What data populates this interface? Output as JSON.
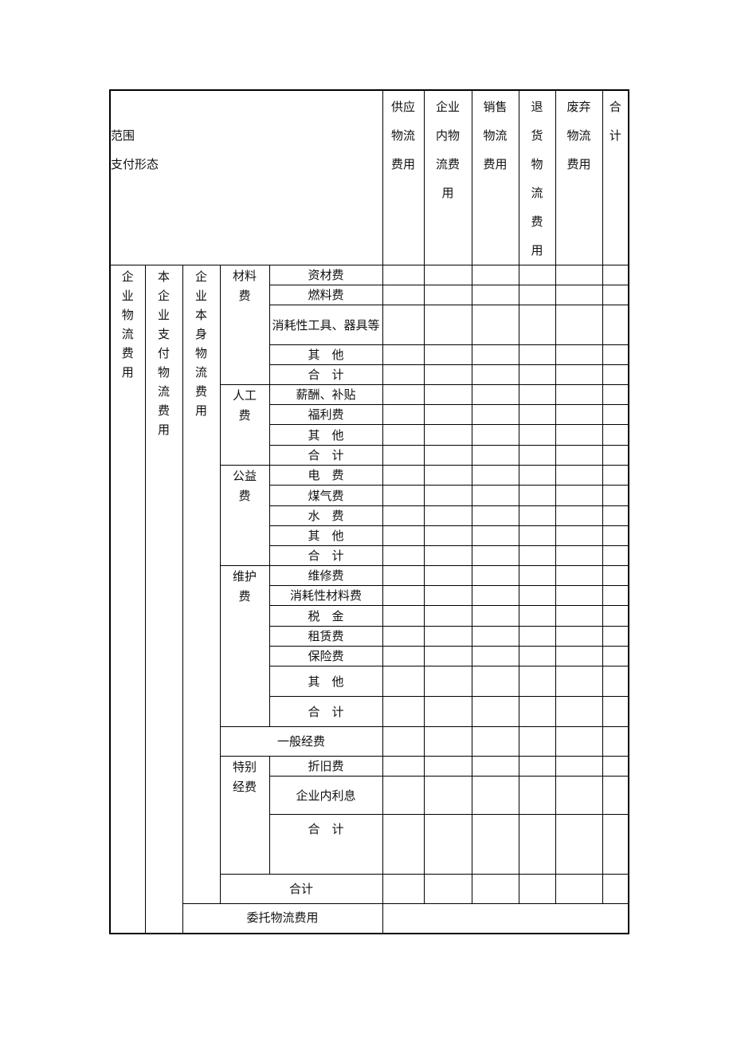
{
  "header": {
    "range_label": "范围",
    "payment_form_label": "支付形态",
    "columns": [
      "供应物流费用",
      "企业内物流费用",
      "销售物流费用",
      "退货物流费用",
      "废弃物流费用",
      "合计"
    ]
  },
  "body": {
    "level1": "企业物流费用",
    "level2": "本企业支付物流费用",
    "level3": "企业本身物流费用",
    "groups": [
      {
        "name": "材料费",
        "items": [
          "资材费",
          "燃料费",
          "消耗性工具、器具等",
          "其　他",
          "合　计"
        ]
      },
      {
        "name": "人工费",
        "items": [
          "薪酬、补贴",
          "福利费",
          "其　他",
          "合　计"
        ]
      },
      {
        "name": "公益费",
        "items": [
          "电　费",
          "煤气费",
          "水　费",
          "其　他",
          "合　计"
        ]
      },
      {
        "name": "维护费",
        "items": [
          "维修费",
          "消耗性材料费",
          "税　金",
          "租赁费",
          "保险费",
          "其　他",
          "合　计"
        ]
      }
    ],
    "general": "一般经费",
    "special": {
      "name": "特别经费",
      "items": [
        "折旧费",
        "企业内利息",
        "合　计"
      ]
    },
    "subtotal": "合计",
    "outsourced": "委托物流费用"
  }
}
